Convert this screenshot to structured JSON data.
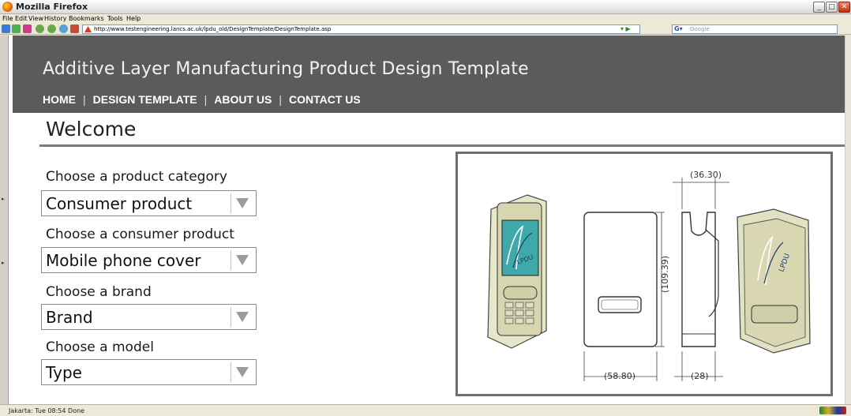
{
  "browser": {
    "title": "Mozilla Firefox",
    "menu": [
      "File",
      "Edit",
      "View",
      "History",
      "Bookmarks",
      "Tools",
      "Help"
    ],
    "url": "http://www.testengineering.lancs.ac.uk/lpdu_old/DesignTemplate/DesignTemplate.asp",
    "search_placeholder": "Google",
    "status": "Jakarta: Tue 08:54   Done"
  },
  "site": {
    "title": "Additive Layer Manufacturing Product Design Template",
    "nav": [
      "HOME",
      "DESIGN TEMPLATE",
      "ABOUT US",
      "CONTACT US"
    ],
    "nav_separator": "|",
    "heading": "Welcome"
  },
  "form": {
    "fields": [
      {
        "label": "Choose a product category",
        "value": "Consumer product"
      },
      {
        "label": "Choose a consumer product",
        "value": "Mobile phone cover"
      },
      {
        "label": "Choose a brand",
        "value": "Brand"
      },
      {
        "label": "Choose a model",
        "value": "Type"
      }
    ]
  },
  "drawing": {
    "dimensions": [
      "(36.30)",
      "(109.39)",
      "(58.80)",
      "(28)"
    ],
    "logo_text": "LPDU"
  },
  "colors": {
    "header_bg": "#5b5b5b",
    "screen_teal": "#3fa9a9"
  }
}
